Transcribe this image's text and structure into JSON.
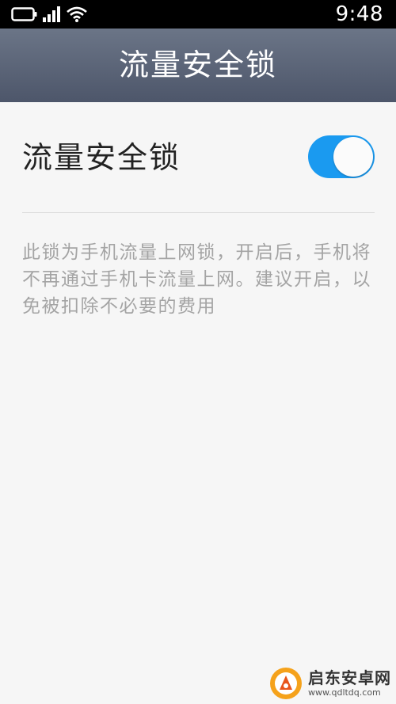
{
  "status_bar": {
    "time": "9:48",
    "icons": [
      "battery-icon",
      "signal-icon",
      "wifi-icon"
    ]
  },
  "header": {
    "title": "流量安全锁"
  },
  "setting": {
    "label": "流量安全锁",
    "toggle_on": true,
    "toggle_color": "#1a9af0"
  },
  "description": "此锁为手机流量上网锁，开启后，手机将不再通过手机卡流量上网。建议开启，以免被扣除不必要的费用",
  "watermark": {
    "title": "启东安卓网",
    "url": "www.qdltdq.com"
  },
  "colors": {
    "status_bar": "#000000",
    "title_bar": "#5b6477",
    "background": "#f6f6f6",
    "description_text": "#a4a4a4"
  }
}
